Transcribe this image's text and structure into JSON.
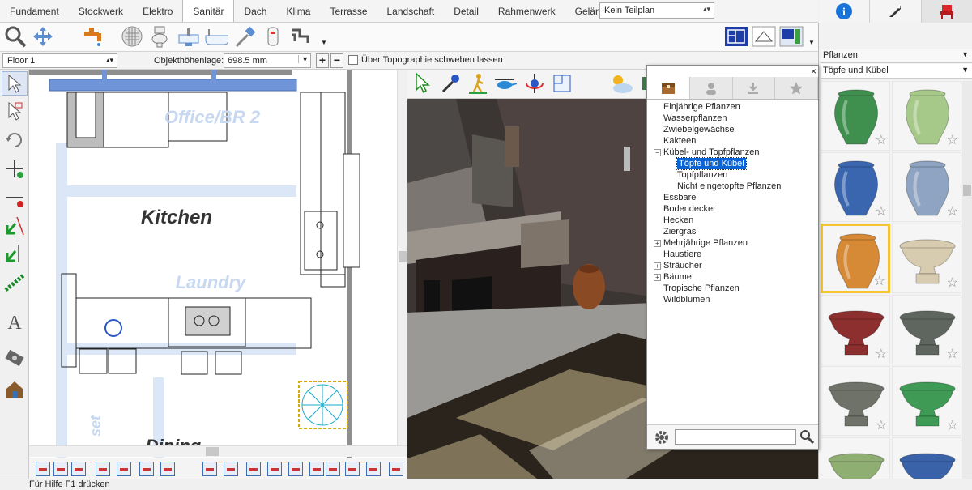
{
  "tabs": [
    {
      "label": "Fundament"
    },
    {
      "label": "Stockwerk"
    },
    {
      "label": "Elektro"
    },
    {
      "label": "Sanitär",
      "active": true
    },
    {
      "label": "Dach"
    },
    {
      "label": "Klima"
    },
    {
      "label": "Terrasse"
    },
    {
      "label": "Landschaft"
    },
    {
      "label": "Detail"
    },
    {
      "label": "Rahmenwerk"
    },
    {
      "label": "Gelände"
    }
  ],
  "teilplan": {
    "value": "Kein Teilplan"
  },
  "level": {
    "floor": "Floor 1",
    "height_label": "Objekthöhenlage:",
    "height_value": "698.5 mm",
    "topo_label": "Über Topographie schweben lassen"
  },
  "plan": {
    "room_labels": [
      "Office/BR 2",
      "Kitchen",
      "Laundry",
      "Dining",
      "set"
    ]
  },
  "catalog": {
    "close": "×",
    "tree": [
      {
        "label": "Einjährige Pflanzen",
        "level": 0,
        "expander": ""
      },
      {
        "label": "Wasserpflanzen",
        "level": 0,
        "expander": ""
      },
      {
        "label": "Zwiebelgewächse",
        "level": 0,
        "expander": ""
      },
      {
        "label": "Kakteen",
        "level": 0,
        "expander": ""
      },
      {
        "label": "Kübel- und Topfpflanzen",
        "level": 0,
        "expander": "−"
      },
      {
        "label": "Töpfe und Kübel",
        "level": 1,
        "expander": "",
        "selected": true
      },
      {
        "label": "Topfpflanzen",
        "level": 1,
        "expander": ""
      },
      {
        "label": "Nicht eingetopfte Pflanzen",
        "level": 1,
        "expander": ""
      },
      {
        "label": "Essbare",
        "level": 0,
        "expander": ""
      },
      {
        "label": "Bodendecker",
        "level": 0,
        "expander": ""
      },
      {
        "label": "Hecken",
        "level": 0,
        "expander": ""
      },
      {
        "label": "Ziergras",
        "level": 0,
        "expander": ""
      },
      {
        "label": "Mehrjährige Pflanzen",
        "level": 0,
        "expander": "+"
      },
      {
        "label": "Haustiere",
        "level": 0,
        "expander": ""
      },
      {
        "label": "Sträucher",
        "level": 0,
        "expander": "+"
      },
      {
        "label": "Bäume",
        "level": 0,
        "expander": "+"
      },
      {
        "label": "Tropische Pflanzen",
        "level": 0,
        "expander": ""
      },
      {
        "label": "Wildblumen",
        "level": 0,
        "expander": ""
      }
    ],
    "search_placeholder": ""
  },
  "library": {
    "category": "Pflanzen",
    "subcategory": "Töpfe und Kübel",
    "items": [
      {
        "color": "#3f8f4f",
        "shape": "vase"
      },
      {
        "color": "#a6c98a",
        "shape": "vase"
      },
      {
        "color": "#3a66b0",
        "shape": "vase"
      },
      {
        "color": "#8fa4c2",
        "shape": "vase"
      },
      {
        "color": "#d68a36",
        "shape": "vase",
        "selected": true
      },
      {
        "color": "#d8ccb0",
        "shape": "urn"
      },
      {
        "color": "#8e2f2f",
        "shape": "urn"
      },
      {
        "color": "#5f6660",
        "shape": "urn"
      },
      {
        "color": "#6e7268",
        "shape": "urn"
      },
      {
        "color": "#3e9a55",
        "shape": "urn"
      },
      {
        "color": "#8fae72",
        "shape": "urn"
      },
      {
        "color": "#3a62a8",
        "shape": "urn"
      }
    ]
  },
  "status": "Für Hilfe F1 drücken",
  "colors": {
    "accent": "#0a64d8",
    "selected_border": "#f5c430",
    "plan_blue": "#4a7fd0"
  }
}
